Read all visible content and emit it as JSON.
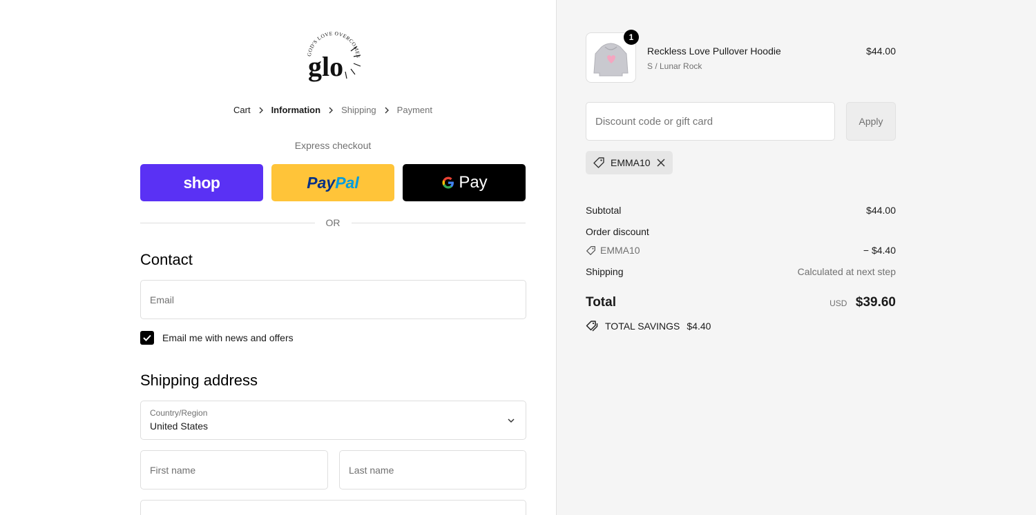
{
  "brand": {
    "logo_text": "GOD'S LOVE OVERCOMES",
    "logo_mark": "glo"
  },
  "breadcrumb": {
    "items": [
      {
        "label": "Cart"
      },
      {
        "label": "Information"
      },
      {
        "label": "Shipping"
      },
      {
        "label": "Payment"
      }
    ]
  },
  "express": {
    "label": "Express checkout",
    "shop_label": "shop",
    "paypal_label_1": "Pay",
    "paypal_label_2": "Pal",
    "gpay_label": "Pay",
    "or_label": "OR"
  },
  "contact": {
    "title": "Contact",
    "email_placeholder": "Email",
    "newsletter_label": "Email me with news and offers",
    "newsletter_checked": true
  },
  "shipping": {
    "title": "Shipping address",
    "country_label": "Country/Region",
    "country_value": "United States",
    "first_name_placeholder": "First name",
    "last_name_placeholder": "Last name"
  },
  "order": {
    "item": {
      "name": "Reckless Love Pullover Hoodie",
      "variant": "S / Lunar Rock",
      "price": "$44.00",
      "quantity": "1"
    },
    "discount_placeholder": "Discount code or gift card",
    "apply_label": "Apply",
    "applied_code": "EMMA10",
    "subtotal_label": "Subtotal",
    "subtotal_value": "$44.00",
    "order_discount_label": "Order discount",
    "discount_code": "EMMA10",
    "discount_value": "− $4.40",
    "shipping_label": "Shipping",
    "shipping_value": "Calculated at next step",
    "total_label": "Total",
    "currency": "USD",
    "total_value": "$39.60",
    "savings_label": "TOTAL SAVINGS",
    "savings_value": "$4.40"
  },
  "colors": {
    "shop": "#5a31f4",
    "paypal": "#ffc439",
    "gpay": "#000000",
    "summary_bg": "#f5f5f5"
  }
}
